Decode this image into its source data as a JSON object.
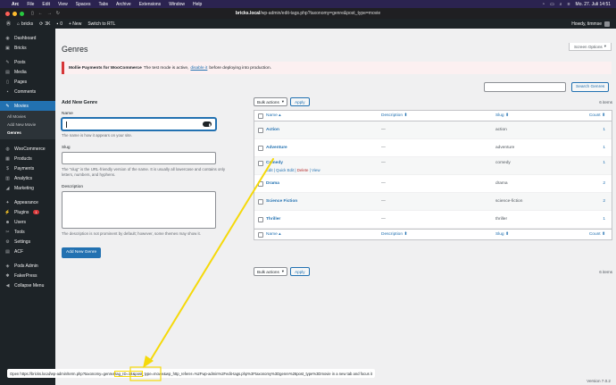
{
  "macbar": {
    "app": "Arc",
    "menus": [
      "File",
      "Edit",
      "View",
      "Spaces",
      "Tabs",
      "Archive",
      "Extensions",
      "Window",
      "Help"
    ],
    "clock": "Mo. 27. Juli  14:51"
  },
  "browser": {
    "url_host": "bricks.local",
    "url_path": "/wp-admin/edit-tags.php?taxonomy=genre&post_type=movie"
  },
  "adminbar": {
    "site": "bricks",
    "updates": "3K",
    "comments": "0",
    "new": "+ New",
    "rtl": "Switch to RTL",
    "howdy": "Howdy, timmse"
  },
  "sidebar": {
    "items": [
      {
        "label": "Dashboard",
        "icon": "dashboard-icon"
      },
      {
        "label": "Bricks",
        "icon": "bricks-icon"
      },
      {
        "label": "Posts",
        "icon": "pin-icon"
      },
      {
        "label": "Media",
        "icon": "media-icon"
      },
      {
        "label": "Pages",
        "icon": "page-icon"
      },
      {
        "label": "Comments",
        "icon": "comment-icon"
      },
      {
        "label": "Movies",
        "icon": "pin-icon"
      },
      {
        "label": "WooCommerce",
        "icon": "woo-icon"
      },
      {
        "label": "Products",
        "icon": "product-icon"
      },
      {
        "label": "Payments",
        "icon": "payments-icon"
      },
      {
        "label": "Analytics",
        "icon": "analytics-icon"
      },
      {
        "label": "Marketing",
        "icon": "marketing-icon"
      },
      {
        "label": "Appearance",
        "icon": "appearance-icon"
      },
      {
        "label": "Plugins",
        "icon": "plugin-icon",
        "badge": "1"
      },
      {
        "label": "Users",
        "icon": "users-icon"
      },
      {
        "label": "Tools",
        "icon": "tools-icon"
      },
      {
        "label": "Settings",
        "icon": "settings-icon"
      },
      {
        "label": "ACF",
        "icon": "acf-icon"
      },
      {
        "label": "Pods Admin",
        "icon": "pods-icon"
      },
      {
        "label": "FakerPress",
        "icon": "fakerpress-icon"
      },
      {
        "label": "Collapse Menu",
        "icon": "collapse-icon"
      }
    ],
    "submenu": [
      "All Movies",
      "Add New Movie",
      "Genres"
    ]
  },
  "page": {
    "title": "Genres",
    "screen_options": "Screen Options",
    "notice_bold": "Mollie Payments for WooCommerce",
    "notice_text": "The test mode is active,",
    "notice_link": "disable it",
    "notice_tail": "before deploying into production."
  },
  "form": {
    "heading": "Add New Genre",
    "name_label": "Name",
    "name_hint": "The name is how it appears on your site.",
    "slug_label": "Slug",
    "slug_hint": "The “slug” is the URL-friendly version of the name. It is usually all lowercase and contains only letters, numbers, and hyphens.",
    "desc_label": "Description",
    "desc_hint": "The description is not prominent by default; however, some themes may show it.",
    "submit": "Add New Genre"
  },
  "table": {
    "search_button": "Search Genres",
    "bulk_label": "Bulk actions",
    "apply": "Apply",
    "items": "6 items",
    "columns": {
      "name": "Name",
      "description": "Description",
      "slug": "Slug",
      "count": "Count"
    },
    "rows": [
      {
        "name": "Action",
        "description": "—",
        "slug": "action",
        "count": "1"
      },
      {
        "name": "Adventure",
        "description": "—",
        "slug": "adventure",
        "count": "1"
      },
      {
        "name": "Comedy",
        "description": "—",
        "slug": "comedy",
        "count": "1"
      },
      {
        "name": "Drama",
        "description": "—",
        "slug": "drama",
        "count": "2"
      },
      {
        "name": "Science Fiction",
        "description": "—",
        "slug": "science-fiction",
        "count": "2"
      },
      {
        "name": "Thriller",
        "description": "—",
        "slug": "thriller",
        "count": "1"
      }
    ],
    "row_actions": {
      "edit": "Edit",
      "quick_edit": "Quick Edit",
      "delete": "Delete",
      "view": "View"
    }
  },
  "footer": {
    "version": "Version 7.0.2"
  },
  "statusbar": {
    "prefix": "Open https://bricks.local/wp-admin/term.php?taxonomy=genre&",
    "highlight": "tag_ID=14&post",
    "suffix": "_type=movie&wp_http_referer=%2Fwp-admin%2Fedit-tags.php%3Ftaxonomy%3Dgenre%26post_type%3Dmovie in a new tab and focus it"
  },
  "colors": {
    "accent": "#2271b1",
    "sidebar": "#1d2327",
    "annotation": "#f5d90a"
  }
}
